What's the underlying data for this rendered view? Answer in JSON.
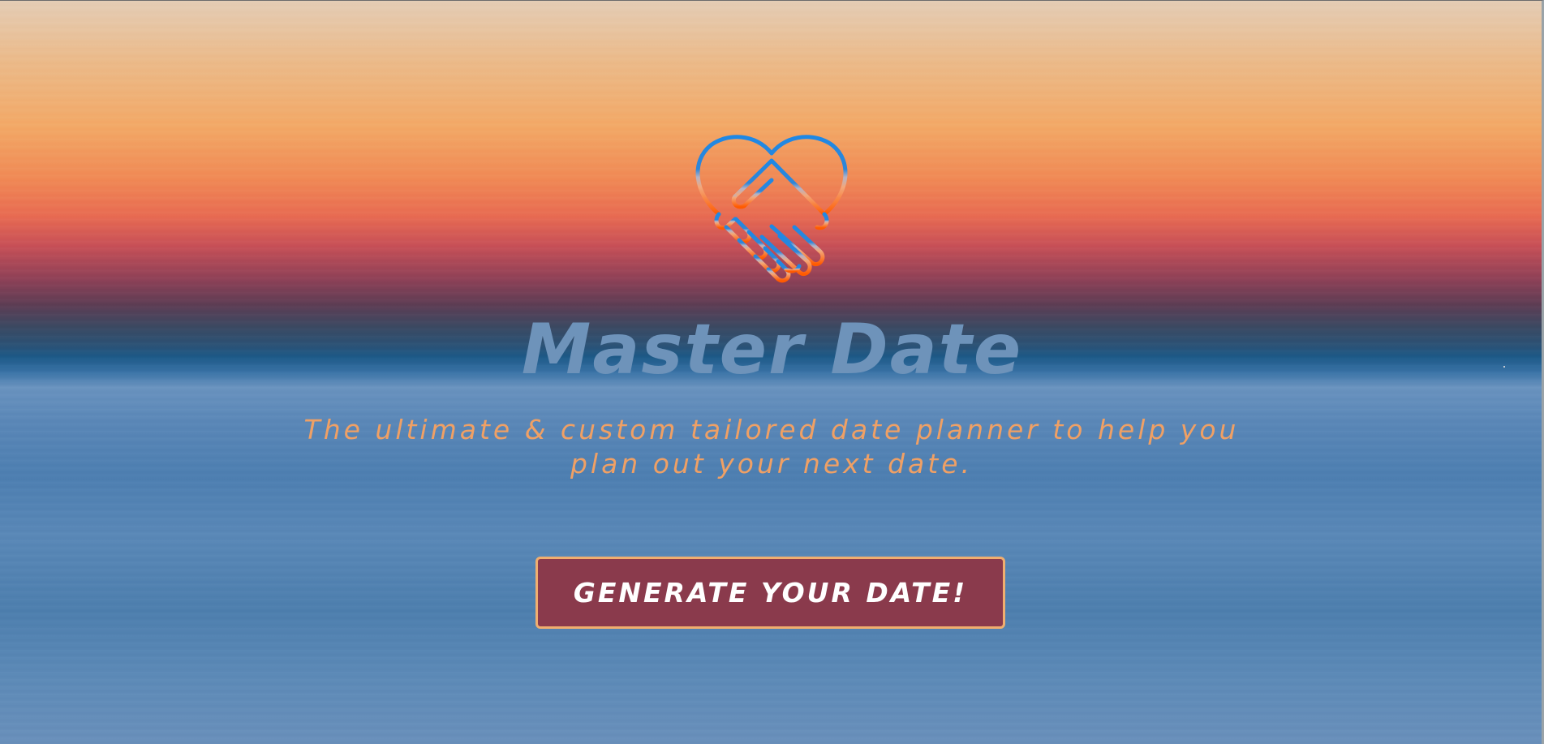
{
  "hero": {
    "logo_icon": "heart-handshake-icon",
    "title": "Master Date",
    "tagline": "The ultimate & custom tailored date planner to help you plan out your next date.",
    "cta_label": "Generate your date!"
  },
  "colors": {
    "title": "#6e93ba",
    "tagline": "#efa065",
    "button_background": "#8a3a4c",
    "button_border": "#f0ae6f",
    "button_text": "#ffffff",
    "logo_gradient_top": "#1e88e5",
    "logo_gradient_bottom": "#ff5a00"
  }
}
